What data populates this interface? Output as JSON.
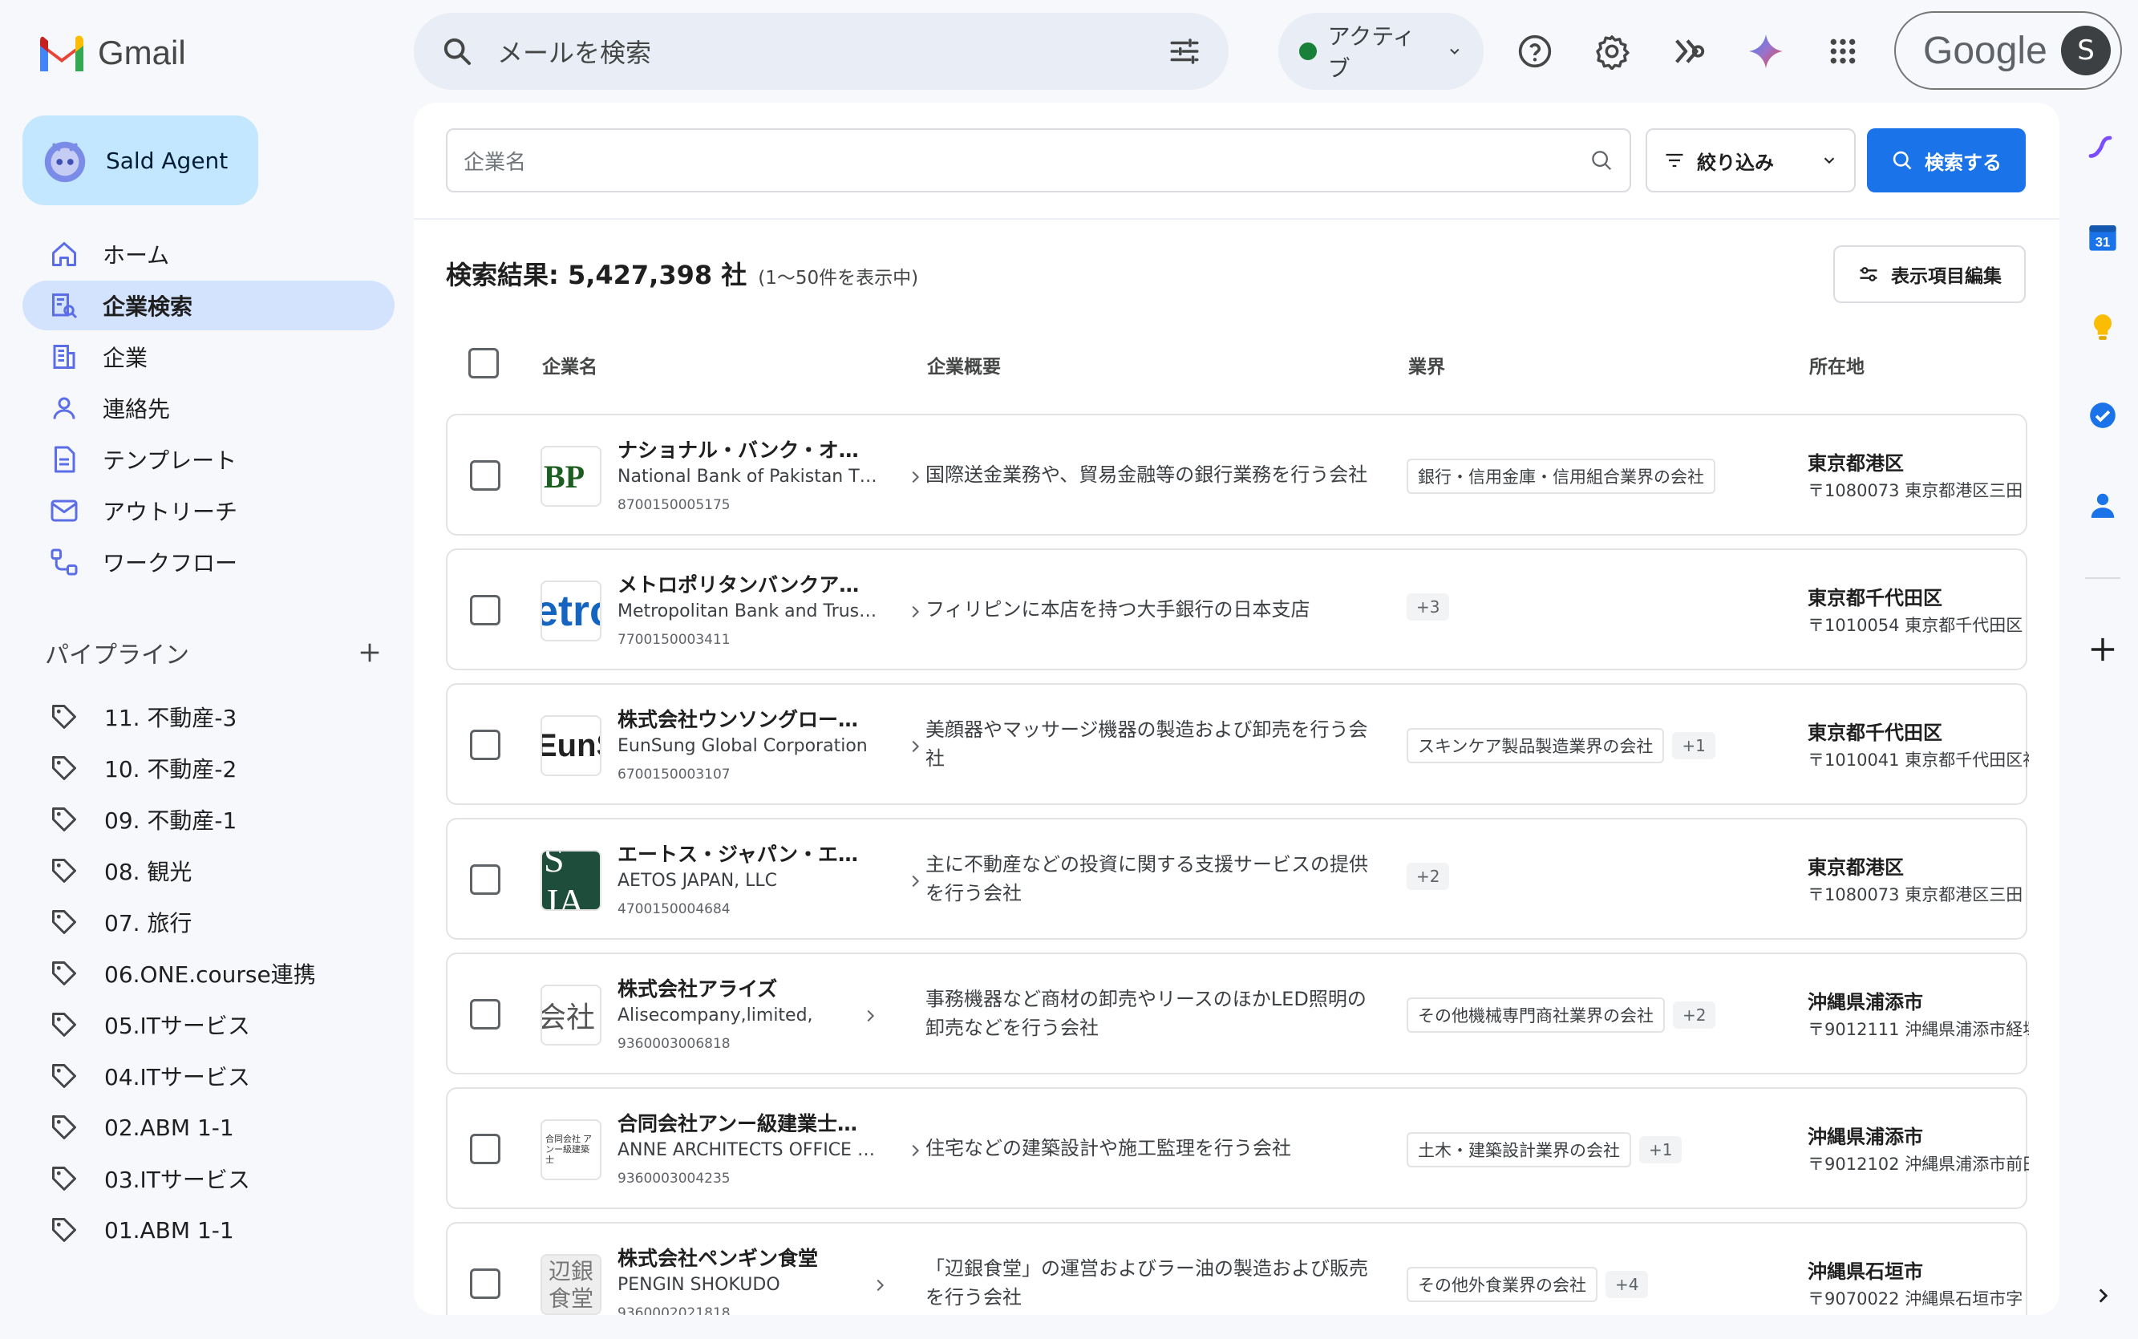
{
  "app": {
    "name": "Gmail"
  },
  "search": {
    "placeholder": "メールを検索"
  },
  "status": {
    "label": "アクティブ"
  },
  "account": {
    "brand": "Google",
    "avatar": "S"
  },
  "agent": {
    "label": "Sald Agent"
  },
  "nav": [
    {
      "label": "ホーム",
      "icon": "home-icon"
    },
    {
      "label": "企業検索",
      "icon": "company-search-icon",
      "active": true
    },
    {
      "label": "企業",
      "icon": "building-icon"
    },
    {
      "label": "連絡先",
      "icon": "person-icon"
    },
    {
      "label": "テンプレート",
      "icon": "document-icon"
    },
    {
      "label": "アウトリーチ",
      "icon": "mail-icon"
    },
    {
      "label": "ワークフロー",
      "icon": "workflow-icon"
    }
  ],
  "pipeline": {
    "title": "パイプライン",
    "items": [
      "11. 不動産-3",
      "10. 不動産-2",
      "09. 不動産-1",
      "08. 観光",
      "07. 旅行",
      "06.ONE.course連携",
      "05.ITサービス",
      "04.ITサービス",
      "02.ABM 1-1",
      "03.ITサービス",
      "01.ABM 1-1"
    ]
  },
  "toolbar": {
    "company_placeholder": "企業名",
    "filter_label": "絞り込み",
    "search_label": "検索する",
    "columns_label": "表示項目編集"
  },
  "results": {
    "title": "検索結果: 5,427,398 社",
    "sub": "(1〜50件を表示中)"
  },
  "columns": {
    "name": "企業名",
    "overview": "企業概要",
    "industry": "業界",
    "location": "所在地"
  },
  "rows": [
    {
      "name": "ナショナル・バンク・オ…",
      "en": "National Bank of Pakistan T…",
      "id": "8700150005175",
      "logo": "BP",
      "desc": "国際送金業務や、貿易金融等の銀行業務を行う会社",
      "tag": "銀行・信用金庫・信用組合業界の会社",
      "more": "",
      "pref": "東京都港区",
      "addr": "〒1080073 東京都港区三田"
    },
    {
      "name": "メトロポリタンバンクア…",
      "en": "Metropolitan Bank and Trus…",
      "id": "7700150003411",
      "logo": "etro",
      "desc": "フィリピンに本店を持つ大手銀行の日本支店",
      "tag": "",
      "more": "+3",
      "pref": "東京都千代田区",
      "addr": "〒1010054 東京都千代田区"
    },
    {
      "name": "株式会社ウンソングロー…",
      "en": "EunSung Global Corporation",
      "id": "6700150003107",
      "logo": "EunS",
      "desc": "美顔器やマッサージ機器の製造および卸売を行う会社",
      "tag": "スキンケア製品製造業界の会社",
      "more": "+1",
      "pref": "東京都千代田区",
      "addr": "〒1010041 東京都千代田区神"
    },
    {
      "name": "エートス・ジャパン・エ…",
      "en": "AETOS JAPAN, LLC",
      "id": "4700150004684",
      "logo": "S JA",
      "desc": "主に不動産などの投資に関する支援サービスの提供を行う会社",
      "tag": "",
      "more": "+2",
      "pref": "東京都港区",
      "addr": "〒1080073 東京都港区三田"
    },
    {
      "name": "株式会社アライズ",
      "en": "Alisecompany,limited,",
      "id": "9360003006818",
      "logo": "会社",
      "desc": "事務機器など商材の卸売やリースのほかLED照明の卸売などを行う会社",
      "tag": "その他機械専門商社業界の会社",
      "more": "+2",
      "pref": "沖縄県浦添市",
      "addr": "〒9012111 沖縄県浦添市経塚"
    },
    {
      "name": "合同会社アンー級建業士…",
      "en": "ANNE ARCHITECTS OFFICE …",
      "id": "9360003004235",
      "logo": "合同会社 アンー級建築士",
      "desc": "住宅などの建築設計や施工監理を行う会社",
      "tag": "土木・建築設計業界の会社",
      "more": "+1",
      "pref": "沖縄県浦添市",
      "addr": "〒9012102 沖縄県浦添市前田"
    },
    {
      "name": "株式会社ペンギン食堂",
      "en": "PENGIN SHOKUDO",
      "id": "9360002021818",
      "logo": "辺銀食堂",
      "desc": "「辺銀食堂」の運営およびラー油の製造および販売を行う会社",
      "tag": "その他外食業界の会社",
      "more": "+4",
      "pref": "沖縄県石垣市",
      "addr": "〒9070022 沖縄県石垣市字"
    }
  ],
  "colors": {
    "accent": "#1a73e8",
    "active_nav": "#d3e3fd",
    "agent_bg": "#c2e7ff"
  },
  "rail": {
    "calendar_day": "31"
  }
}
